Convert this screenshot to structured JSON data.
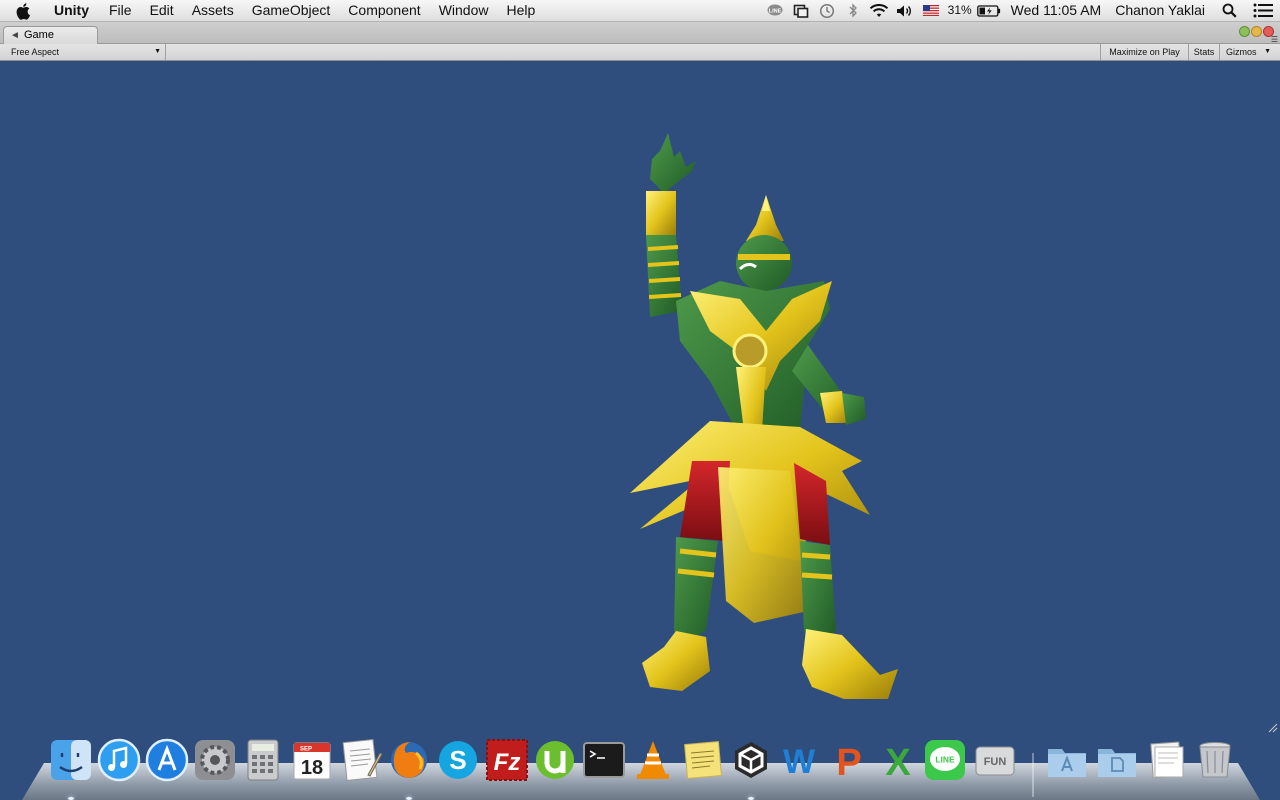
{
  "menubar": {
    "app_name": "Unity",
    "items": [
      "File",
      "Edit",
      "Assets",
      "GameObject",
      "Component",
      "Window",
      "Help"
    ],
    "status_icons": [
      "line-icon",
      "window-icon",
      "time-machine-icon",
      "bluetooth-icon",
      "wifi-icon",
      "volume-icon",
      "us-flag-icon"
    ],
    "battery": "31%",
    "clock": "Wed 11:05 AM",
    "user": "Chanon Yaklai"
  },
  "window": {
    "tab_label": "Game",
    "aspect": "Free Aspect",
    "maximize_on_play": "Maximize on Play",
    "stats": "Stats",
    "gizmos": "Gizmos"
  },
  "viewport": {
    "background_color": "#2f4e7d",
    "subject": "thai-giant-yaksha-character"
  },
  "dock": {
    "apps": [
      {
        "name": "Finder",
        "icon": "finder-icon"
      },
      {
        "name": "iTunes",
        "icon": "itunes-icon"
      },
      {
        "name": "App Store",
        "icon": "app-store-icon"
      },
      {
        "name": "System Preferences",
        "icon": "system-preferences-icon"
      },
      {
        "name": "Calculator",
        "icon": "calculator-icon"
      },
      {
        "name": "Calendar",
        "icon": "calendar-icon",
        "date_label": "18",
        "month_label": "SEP"
      },
      {
        "name": "TextEdit",
        "icon": "textedit-icon"
      },
      {
        "name": "Firefox",
        "icon": "firefox-icon"
      },
      {
        "name": "Skype",
        "icon": "skype-icon"
      },
      {
        "name": "FileZilla",
        "icon": "filezilla-icon"
      },
      {
        "name": "uTorrent",
        "icon": "utorrent-icon"
      },
      {
        "name": "Terminal",
        "icon": "terminal-icon"
      },
      {
        "name": "VLC",
        "icon": "vlc-icon"
      },
      {
        "name": "Stickies",
        "icon": "stickies-icon"
      },
      {
        "name": "Unity",
        "icon": "unity-icon"
      },
      {
        "name": "Word",
        "icon": "word-icon"
      },
      {
        "name": "PowerPoint",
        "icon": "powerpoint-icon"
      },
      {
        "name": "Excel",
        "icon": "excel-icon"
      },
      {
        "name": "LINE",
        "icon": "line-app-icon"
      },
      {
        "name": "FUN",
        "icon": "fun-drive-icon"
      },
      {
        "name": "Applications",
        "icon": "applications-folder-icon"
      },
      {
        "name": "Documents",
        "icon": "documents-folder-icon"
      },
      {
        "name": "Downloads",
        "icon": "downloads-stack-icon"
      },
      {
        "name": "Trash",
        "icon": "trash-icon"
      }
    ]
  }
}
